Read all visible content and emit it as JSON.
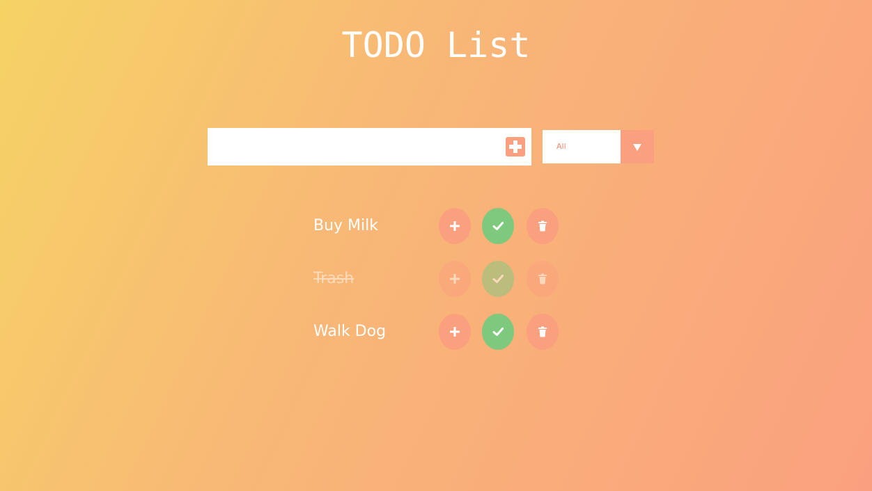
{
  "header": {
    "title": "TODO List"
  },
  "new_todo": {
    "value": "",
    "placeholder": "",
    "add_icon": "plus-square-icon"
  },
  "filter": {
    "selected": "All",
    "arrow_icon": "caret-down-icon"
  },
  "todos": [
    {
      "text": "Buy Milk",
      "completed": false
    },
    {
      "text": "Trash",
      "completed": true
    },
    {
      "text": "Walk Dog",
      "completed": false
    }
  ],
  "item_actions": {
    "plus_icon": "plus-icon",
    "check_icon": "check-icon",
    "trash_icon": "trash-icon"
  },
  "colors": {
    "gradient_start": "#f6d365",
    "gradient_end": "#fba07f",
    "accent": "#fba07f",
    "complete_green": "#7fc97f",
    "text_white": "#ffffff"
  }
}
